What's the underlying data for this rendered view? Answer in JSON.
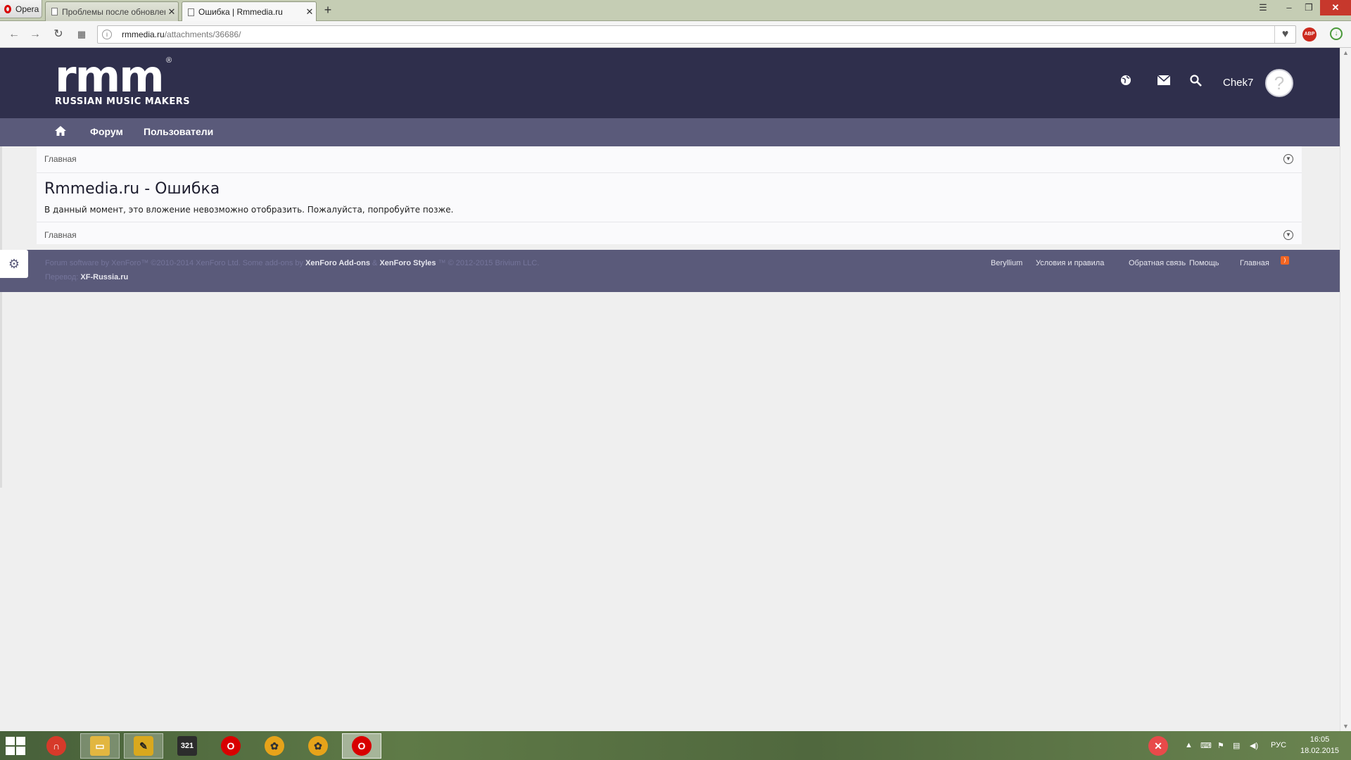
{
  "browser": {
    "menu_label": "Opera",
    "tabs": [
      {
        "title": "Проблемы после обновления",
        "close": "✕"
      },
      {
        "title": "Ошибка | Rmmedia.ru",
        "close": "✕"
      }
    ],
    "new_tab": "+",
    "url_host": "rmmedia.ru",
    "url_path": "/attachments/36686/",
    "adblock_label": "ABP",
    "window_controls": {
      "menu": "☰",
      "minimize": "–",
      "maximize": "❐",
      "close": "✕"
    }
  },
  "site": {
    "logo_main": "rmm",
    "logo_sub": "RUSSIAN MUSIC MAKERS",
    "logo_reg": "®",
    "user_name": "Chek7",
    "nav": [
      {
        "label": "Форум"
      },
      {
        "label": "Пользователи"
      }
    ],
    "breadcrumb_top": "Главная",
    "breadcrumb_bottom": "Главная",
    "error_title": "Rmmedia.ru - Ошибка",
    "error_message": "В данный момент, это вложение невозможно отобразить. Пожалуйста, попробуйте позже."
  },
  "footer": {
    "credit_prefix": "Forum software by XenForo™ ©2010-2014 XenForo Ltd. Some add-ons by",
    "addons_link": "XenForo Add-ons",
    "amp": "&",
    "styles_link": "XenForo Styles",
    "credit_suffix": "™ © 2012-2015 Brivium LLC.",
    "translation_prefix": "Перевод:",
    "translation_link": "XF-Russia.ru",
    "links": [
      "Beryllium",
      "Условия и правила",
      "Обратная связь",
      "Помощь",
      "Главная"
    ]
  },
  "taskbar": {
    "language": "РУС",
    "time": "16:05",
    "date": "18.02.2015"
  },
  "colors": {
    "header_bg": "#2f2f4c",
    "nav_bg": "#5a5a7a",
    "footer_bg": "#5a5a7a",
    "page_bg": "#efefef",
    "content_bg": "#fafafc",
    "opera_red": "#d80000"
  },
  "icons": [
    "globe-icon",
    "mail-icon",
    "search-icon",
    "home-icon",
    "gear-icon",
    "rss-icon",
    "chevron-down-circle-icon",
    "heart-icon"
  ]
}
